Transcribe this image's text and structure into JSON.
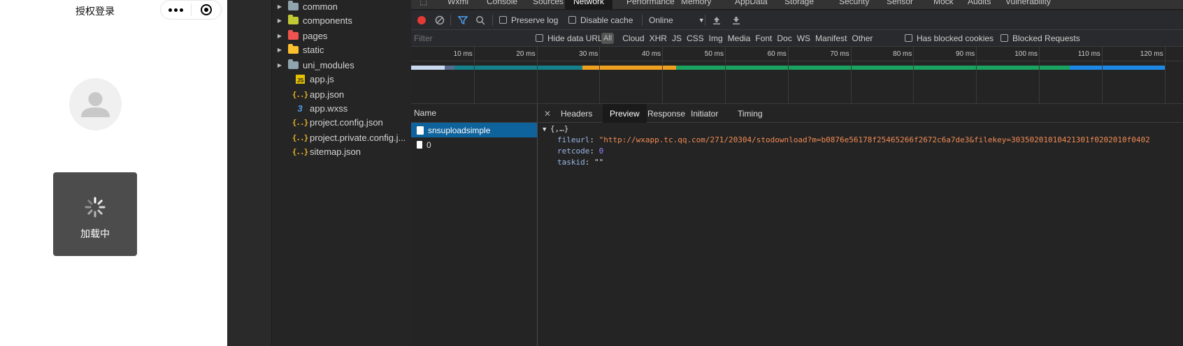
{
  "simulator": {
    "title": "授权登录",
    "toast_text": "加载中"
  },
  "explorer": {
    "items": [
      {
        "label": "common",
        "type": "folder",
        "color": "#90a4ae"
      },
      {
        "label": "components",
        "type": "folder",
        "color": "#c0ca33"
      },
      {
        "label": "pages",
        "type": "folder",
        "color": "#ef5350"
      },
      {
        "label": "static",
        "type": "folder",
        "color": "#fbc02d"
      },
      {
        "label": "uni_modules",
        "type": "folder",
        "color": "#90a4ae"
      },
      {
        "label": "app.js",
        "type": "js"
      },
      {
        "label": "app.json",
        "type": "json"
      },
      {
        "label": "app.wxss",
        "type": "css"
      },
      {
        "label": "project.config.json",
        "type": "json"
      },
      {
        "label": "project.private.config.j...",
        "type": "json"
      },
      {
        "label": "sitemap.json",
        "type": "json"
      }
    ]
  },
  "devtools": {
    "tabs": [
      "Wxml",
      "Console",
      "Sources",
      "Network",
      "Performance",
      "Memory",
      "AppData",
      "Storage",
      "Security",
      "Sensor",
      "Mock",
      "Audits",
      "Vulnerability"
    ],
    "active_tab": "Network",
    "toolbar": {
      "preserve_log": "Preserve log",
      "disable_cache": "Disable cache",
      "throttle": "Online"
    },
    "filter": {
      "placeholder": "Filter",
      "hide_data_urls": "Hide data URLs",
      "types": [
        "All",
        "Cloud",
        "XHR",
        "JS",
        "CSS",
        "Img",
        "Media",
        "Font",
        "Doc",
        "WS",
        "Manifest",
        "Other"
      ],
      "has_blocked_cookies": "Has blocked cookies",
      "blocked_requests": "Blocked Requests"
    },
    "timeline": {
      "ticks": [
        "10 ms",
        "20 ms",
        "30 ms",
        "40 ms",
        "50 ms",
        "60 ms",
        "70 ms",
        "80 ms",
        "90 ms",
        "100 ms",
        "110 ms",
        "120 ms"
      ]
    },
    "requests": {
      "header": "Name",
      "items": [
        {
          "name": "snsuploadsimple",
          "selected": true
        },
        {
          "name": "0",
          "selected": false
        }
      ]
    },
    "detail": {
      "tabs": [
        "Headers",
        "Preview",
        "Response",
        "Initiator",
        "Timing"
      ],
      "active_tab": "Preview",
      "root": "{,…}",
      "fields": [
        {
          "key": "fileurl",
          "value": "\"http://wxapp.tc.qq.com/271/20304/stodownload?m=b0876e56178f25465266f2672c6a7de3&filekey=30350201010421301f0202010f0402",
          "kind": "string"
        },
        {
          "key": "retcode",
          "value": "0",
          "kind": "number"
        },
        {
          "key": "taskid",
          "value": "\"\"",
          "kind": "string"
        }
      ]
    }
  }
}
